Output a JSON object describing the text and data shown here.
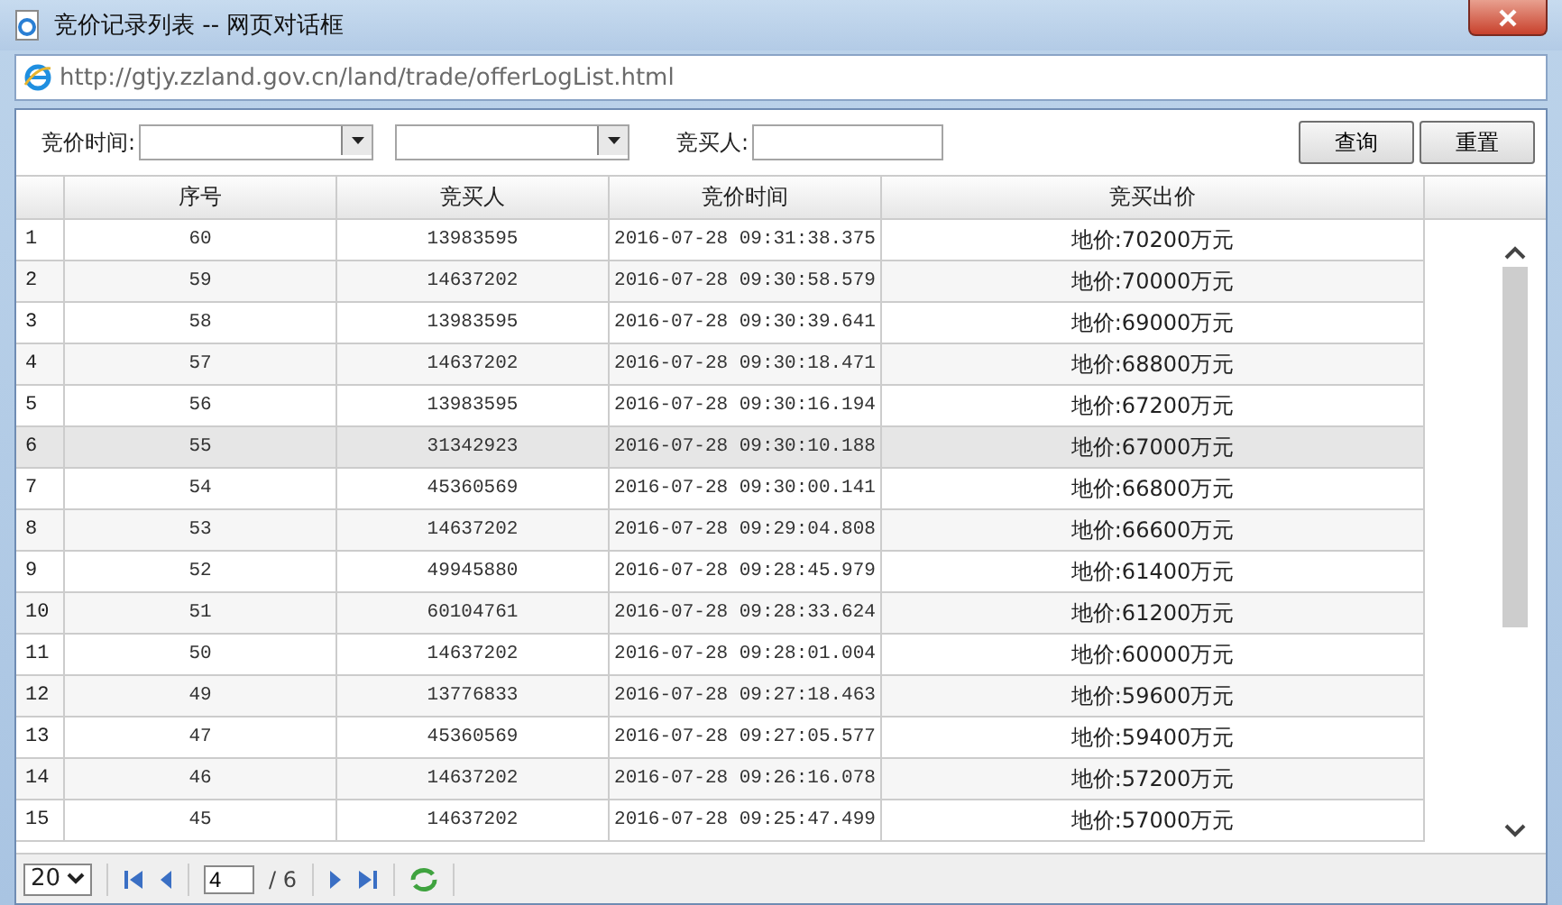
{
  "window": {
    "title": "竞价记录列表 -- 网页对话框"
  },
  "address_bar": {
    "url": "http://gtjy.zzland.gov.cn/land/trade/offerLogList.html"
  },
  "filter": {
    "time_label": "竞价时间:",
    "buyer_label": "竞买人:",
    "buttons": [
      "查询",
      "重置"
    ]
  },
  "table": {
    "columns": [
      "序号",
      "竞买人",
      "竞价时间",
      "竞买出价"
    ],
    "rows": [
      {
        "row_number": "1",
        "serial": "60",
        "buyer": "13983595",
        "time": "2016-07-28 09:31:38.375",
        "price": "地价:70200万元",
        "selected": false
      },
      {
        "row_number": "2",
        "serial": "59",
        "buyer": "14637202",
        "time": "2016-07-28 09:30:58.579",
        "price": "地价:70000万元",
        "selected": false
      },
      {
        "row_number": "3",
        "serial": "58",
        "buyer": "13983595",
        "time": "2016-07-28 09:30:39.641",
        "price": "地价:69000万元",
        "selected": false
      },
      {
        "row_number": "4",
        "serial": "57",
        "buyer": "14637202",
        "time": "2016-07-28 09:30:18.471",
        "price": "地价:68800万元",
        "selected": false
      },
      {
        "row_number": "5",
        "serial": "56",
        "buyer": "13983595",
        "time": "2016-07-28 09:30:16.194",
        "price": "地价:67200万元",
        "selected": false
      },
      {
        "row_number": "6",
        "serial": "55",
        "buyer": "31342923",
        "time": "2016-07-28 09:30:10.188",
        "price": "地价:67000万元",
        "selected": true
      },
      {
        "row_number": "7",
        "serial": "54",
        "buyer": "45360569",
        "time": "2016-07-28 09:30:00.141",
        "price": "地价:66800万元",
        "selected": false
      },
      {
        "row_number": "8",
        "serial": "53",
        "buyer": "14637202",
        "time": "2016-07-28 09:29:04.808",
        "price": "地价:66600万元",
        "selected": false
      },
      {
        "row_number": "9",
        "serial": "52",
        "buyer": "49945880",
        "time": "2016-07-28 09:28:45.979",
        "price": "地价:61400万元",
        "selected": false
      },
      {
        "row_number": "10",
        "serial": "51",
        "buyer": "60104761",
        "time": "2016-07-28 09:28:33.624",
        "price": "地价:61200万元",
        "selected": false
      },
      {
        "row_number": "11",
        "serial": "50",
        "buyer": "14637202",
        "time": "2016-07-28 09:28:01.004",
        "price": "地价:60000万元",
        "selected": false
      },
      {
        "row_number": "12",
        "serial": "49",
        "buyer": "13776833",
        "time": "2016-07-28 09:27:18.463",
        "price": "地价:59600万元",
        "selected": false
      },
      {
        "row_number": "13",
        "serial": "47",
        "buyer": "45360569",
        "time": "2016-07-28 09:27:05.577",
        "price": "地价:59400万元",
        "selected": false
      },
      {
        "row_number": "14",
        "serial": "46",
        "buyer": "14637202",
        "time": "2016-07-28 09:26:16.078",
        "price": "地价:57200万元",
        "selected": false
      },
      {
        "row_number": "15",
        "serial": "45",
        "buyer": "14637202",
        "time": "2016-07-28 09:25:47.499",
        "price": "地价:57000万元",
        "selected": false
      }
    ]
  },
  "pager": {
    "page_size": "20",
    "page": "4",
    "total": "/ 6"
  }
}
